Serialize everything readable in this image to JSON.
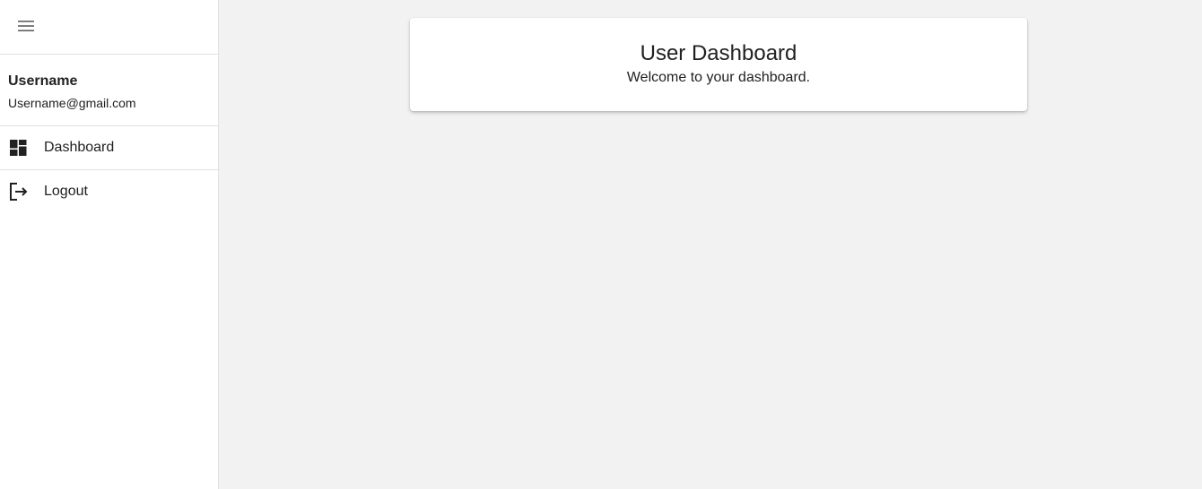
{
  "sidebar": {
    "menu_icon": "hamburger-menu-icon",
    "user": {
      "name": "Username",
      "email": "Username@gmail.com"
    },
    "items": [
      {
        "label": "Dashboard",
        "icon": "dashboard-icon"
      },
      {
        "label": "Logout",
        "icon": "logout-icon"
      }
    ]
  },
  "main": {
    "card": {
      "title": "User Dashboard",
      "subtitle": "Welcome to your dashboard."
    }
  },
  "colors": {
    "background": "#f2f2f2",
    "surface": "#ffffff",
    "text": "#212121",
    "divider": "#e0e0e0"
  }
}
